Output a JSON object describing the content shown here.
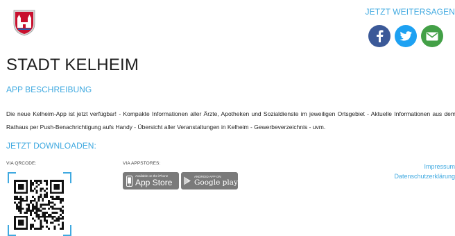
{
  "header": {
    "share_label": "JETZT WEITERSAGEN",
    "share_icons": [
      {
        "icon": "facebook-icon",
        "color": "#3b5998"
      },
      {
        "icon": "twitter-icon",
        "color": "#1da1f2"
      },
      {
        "icon": "mail-icon",
        "color": "#43a047"
      }
    ]
  },
  "brand": {
    "crest_icon": "city-crest-icon"
  },
  "title": "STADT KELHEIM",
  "section_app": {
    "heading": "APP BESCHREIBUNG",
    "description": "Die neue Kelheim-App ist jetzt verfügbar! - Kompakte Informationen aller Ärzte, Apotheken und Sozialdienste im jeweiligen Ortsgebiet - Aktuelle Informationen aus dem Rathaus per Push-Benachrichtigung aufs Handy - Übersicht aller Veranstaltungen in Kelheim - Gewerbeverzeichnis - uvm."
  },
  "section_download": {
    "heading": "JETZT DOWNLOADEN:",
    "qr_label": "VIA QRCODE:",
    "stores_label": "VIA APPSTORES:",
    "appstore": {
      "small": "Available on the iPhone",
      "big": "App Store"
    },
    "googleplay": {
      "small": "ANDROID APP ON",
      "big": "Google play"
    }
  },
  "footer_links": {
    "impressum": "Impressum",
    "privacy": "Datenschutzerklärung"
  },
  "colors": {
    "accent": "#3fa9e0",
    "badge": "#7a7a7a"
  }
}
